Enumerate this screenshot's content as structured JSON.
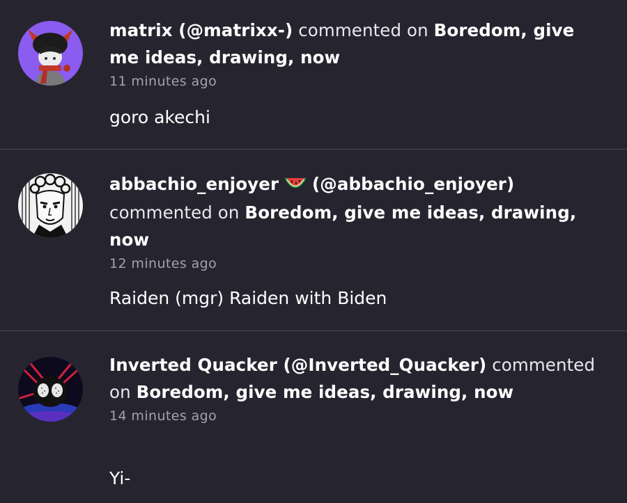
{
  "comments": [
    {
      "author_display": "matrix (@matrixx-)",
      "verb": "commented on",
      "post_title": "Boredom, give me ideas, drawing, now",
      "time": "11 minutes ago",
      "text": "goro akechi",
      "avatar_icon": "horned-character-avatar"
    },
    {
      "author_name": "abbachio_enjoyer",
      "author_emoji": "watermelon-icon",
      "author_handle": "(@abbachio_enjoyer)",
      "verb": "commented on",
      "post_title": "Boredom, give me ideas, drawing, now",
      "time": "12 minutes ago",
      "text": "Raiden (mgr) Raiden with Biden",
      "avatar_icon": "manga-character-avatar"
    },
    {
      "author_display": "Inverted Quacker (@Inverted_Quacker)",
      "verb": "commented on",
      "post_title": "Boredom, give me ideas, drawing, now",
      "time": "14 minutes ago",
      "text": "Yi-",
      "avatar_icon": "masked-character-avatar"
    }
  ],
  "colors": {
    "background": "#26252f",
    "divider": "#4a4955",
    "muted_text": "#a3a2ad"
  }
}
